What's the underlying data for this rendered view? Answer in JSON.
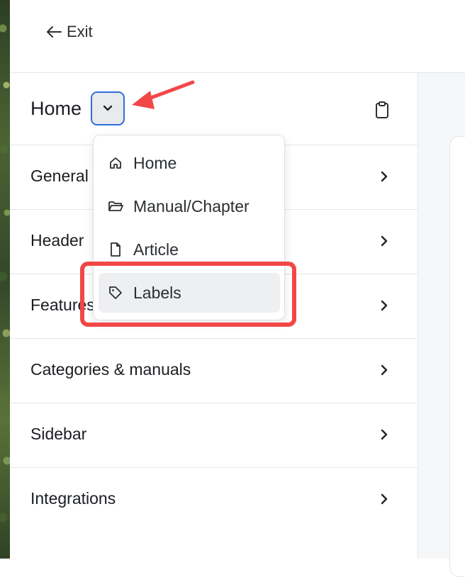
{
  "topbar": {
    "exit_label": "Exit"
  },
  "panel": {
    "title": "Home",
    "rows": [
      {
        "label": "General"
      },
      {
        "label": "Header"
      },
      {
        "label": "Features"
      },
      {
        "label": "Categories & manuals"
      },
      {
        "label": "Sidebar"
      },
      {
        "label": "Integrations"
      }
    ]
  },
  "dropdown": {
    "items": [
      {
        "label": "Home",
        "icon": "home-icon"
      },
      {
        "label": "Manual/Chapter",
        "icon": "folder-icon"
      },
      {
        "label": "Article",
        "icon": "file-icon"
      },
      {
        "label": "Labels",
        "icon": "tag-icon",
        "highlighted": true
      }
    ]
  },
  "colors": {
    "accent": "#2f6fd6",
    "annotation": "#f24747"
  }
}
